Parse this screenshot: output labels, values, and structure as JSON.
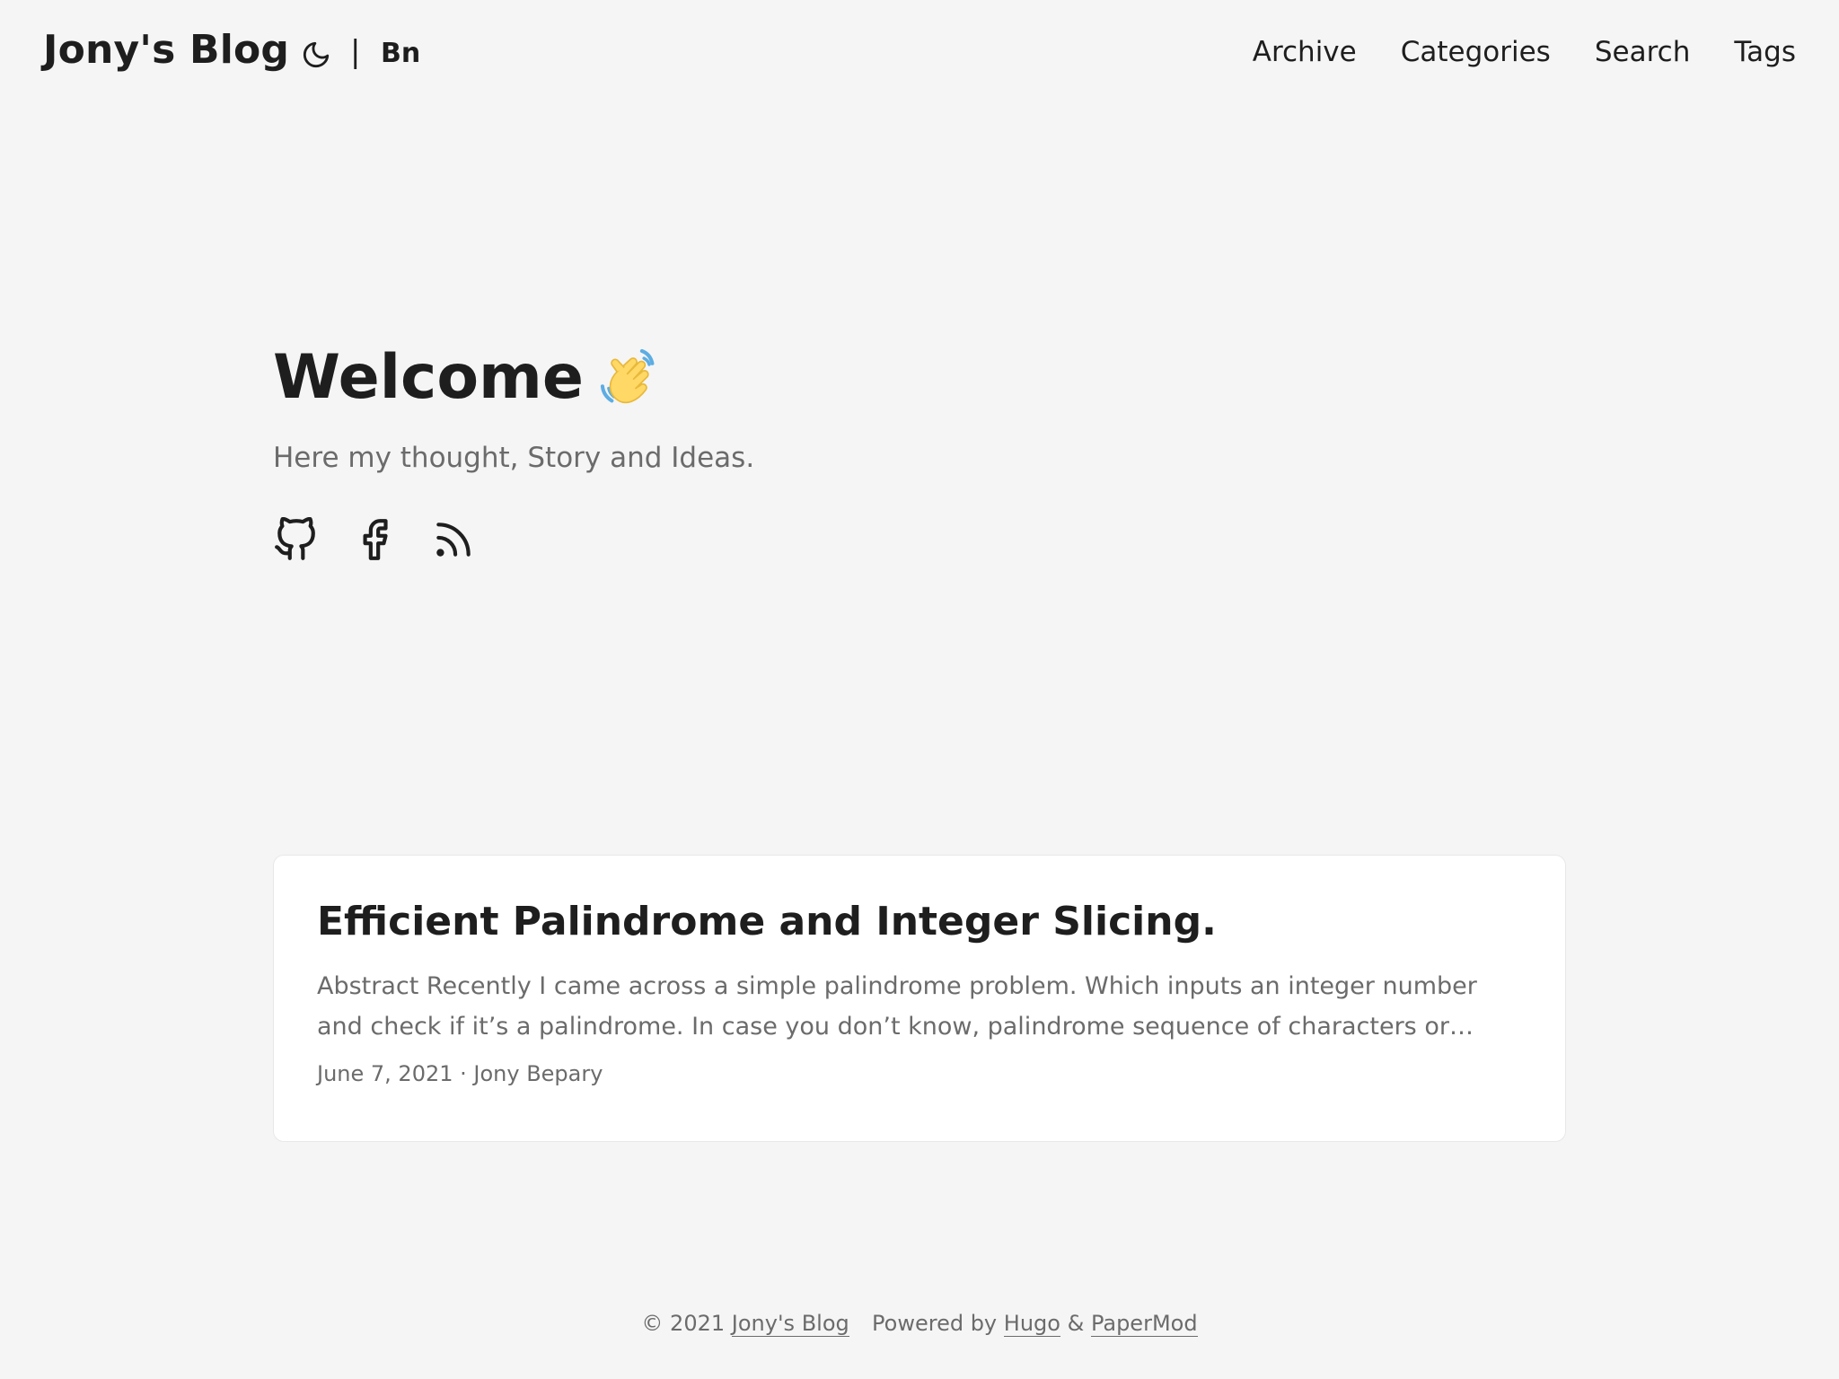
{
  "header": {
    "logo": "Jony's Blog",
    "theme_toggle_icon": "moon-icon",
    "lang_separator": "|",
    "lang_label": "Bn",
    "nav": [
      "Archive",
      "Categories",
      "Search",
      "Tags"
    ]
  },
  "hero": {
    "title": "Welcome",
    "title_icon": "waving-hand-icon",
    "subtitle": "Here my thought, Story and Ideas.",
    "social_icons": [
      "github-icon",
      "facebook-icon",
      "rss-icon"
    ]
  },
  "post": {
    "title": "Efficient Palindrome and Integer Slicing.",
    "excerpt": "Abstract Recently I came across a simple palindrome problem. Which inputs an integer number and check if it’s a palindrome. In case you don’t know, palindrome sequence of characters or number which reads th…",
    "meta": "June 7, 2021 · Jony Bepary"
  },
  "footer": {
    "copyright": "© 2021",
    "site_link": "Jony's Blog",
    "powered_by": "Powered by",
    "hugo_link": "Hugo",
    "amp": "&",
    "theme_link": "PaperMod"
  },
  "colors": {
    "background": "#f5f5f5",
    "text_primary": "#1e1e1e",
    "text_secondary": "#6b6b6b",
    "card_background": "#ffffff",
    "wave_skin": "#ffd866",
    "wave_motion": "#5dade2"
  }
}
